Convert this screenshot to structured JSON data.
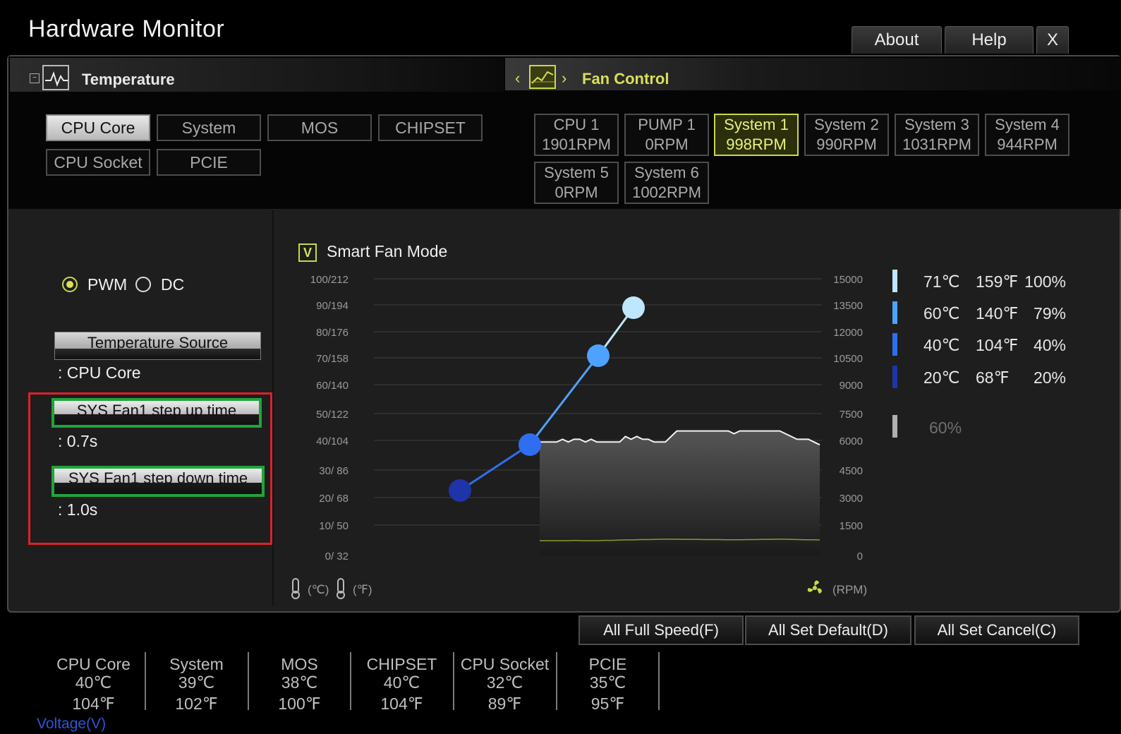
{
  "window": {
    "title": "Hardware Monitor",
    "buttons": {
      "about": "About",
      "help": "Help",
      "close": "X"
    }
  },
  "temperature": {
    "section_title": "Temperature",
    "sources": [
      "CPU Core",
      "System",
      "MOS",
      "CHIPSET",
      "CPU Socket",
      "PCIE"
    ],
    "active_source": "CPU Core"
  },
  "fan_control": {
    "section_title": "Fan Control",
    "fans": [
      {
        "name": "CPU 1",
        "rpm": "1901RPM"
      },
      {
        "name": "PUMP 1",
        "rpm": "0RPM"
      },
      {
        "name": "System 1",
        "rpm": "998RPM"
      },
      {
        "name": "System 2",
        "rpm": "990RPM"
      },
      {
        "name": "System 3",
        "rpm": "1031RPM"
      },
      {
        "name": "System 4",
        "rpm": "944RPM"
      },
      {
        "name": "System 5",
        "rpm": "0RPM"
      },
      {
        "name": "System 6",
        "rpm": "1002RPM"
      }
    ],
    "active_fan": "System 1"
  },
  "left_panel": {
    "pwm_label": "PWM",
    "dc_label": "DC",
    "mode_selected": "PWM",
    "temp_source_label": "Temperature Source",
    "temp_source_value": ": CPU Core",
    "step_up_label": "SYS Fan1 step up time",
    "step_up_value": ": 0.7s",
    "step_down_label": "SYS Fan1 step down time",
    "step_down_value": ": 1.0s"
  },
  "chart_panel": {
    "checkbox_mark": "V",
    "smart_fan_label": "Smart Fan Mode",
    "smart_fan_checked": true,
    "unit_c": "(℃)",
    "unit_f": "(℉)",
    "unit_rpm": "(RPM)"
  },
  "chart_data": {
    "type": "line",
    "y_left_ticks": [
      "100/212",
      "90/194",
      "80/176",
      "70/158",
      "60/140",
      "50/122",
      "40/104",
      "30/  86",
      "20/  68",
      "10/  50",
      "0/  32"
    ],
    "y_right_ticks": [
      "15000",
      "13500",
      "12000",
      "10500",
      "9000",
      "7500",
      "6000",
      "4500",
      "3000",
      "1500",
      "0"
    ],
    "ylim_celsius": [
      0,
      100
    ],
    "series": [
      {
        "role": "fan-curve",
        "points": [
          {
            "temp_c": 20,
            "pct": 20
          },
          {
            "temp_c": 40,
            "pct": 40
          },
          {
            "temp_c": 60,
            "pct": 79
          },
          {
            "temp_c": 71,
            "pct": 100
          }
        ]
      }
    ],
    "temperature_history_c": [
      41,
      41,
      41,
      41,
      42,
      41,
      42,
      42,
      41,
      42,
      41,
      41,
      41,
      41,
      41,
      43,
      42,
      43,
      42,
      42,
      41,
      41,
      41,
      43,
      45,
      45,
      45,
      45,
      45,
      45,
      45,
      45,
      45,
      45,
      44,
      45,
      45,
      45,
      45,
      45,
      45,
      45,
      45,
      44,
      43,
      42,
      42,
      42,
      41,
      40
    ],
    "rpm_history": [
      800,
      800,
      800,
      800,
      800,
      820,
      800,
      800,
      800,
      820,
      820,
      830,
      840,
      840,
      860,
      860,
      870,
      880,
      880,
      880,
      870,
      870,
      870,
      860,
      860,
      860,
      850,
      850,
      850,
      860,
      860,
      870,
      870,
      880,
      880,
      870,
      860,
      850,
      850,
      840
    ]
  },
  "legend": {
    "rows": [
      {
        "c": "71℃",
        "f": "159℉",
        "pct": "100%",
        "color": "#bfe6ff"
      },
      {
        "c": "60℃",
        "f": "140℉",
        "pct": "79%",
        "color": "#4ea2ff"
      },
      {
        "c": "40℃",
        "f": "104℉",
        "pct": "40%",
        "color": "#2f6ef0"
      },
      {
        "c": "20℃",
        "f": "68℉",
        "pct": "20%",
        "color": "#1e34a8"
      }
    ],
    "min_pct": "60%"
  },
  "bottom_buttons": {
    "full_speed": "All Full Speed(F)",
    "set_default": "All Set Default(D)",
    "set_cancel": "All Set Cancel(C)"
  },
  "stats": [
    {
      "name": "CPU Core",
      "c": "40℃",
      "f": "104℉"
    },
    {
      "name": "System",
      "c": "39℃",
      "f": "102℉"
    },
    {
      "name": "MOS",
      "c": "38℃",
      "f": "100℉"
    },
    {
      "name": "CHIPSET",
      "c": "40℃",
      "f": "104℉"
    },
    {
      "name": "CPU Socket",
      "c": "32℃",
      "f": "89℉"
    },
    {
      "name": "PCIE",
      "c": "35℃",
      "f": "95℉"
    }
  ],
  "voltage_label": "Voltage(V)"
}
